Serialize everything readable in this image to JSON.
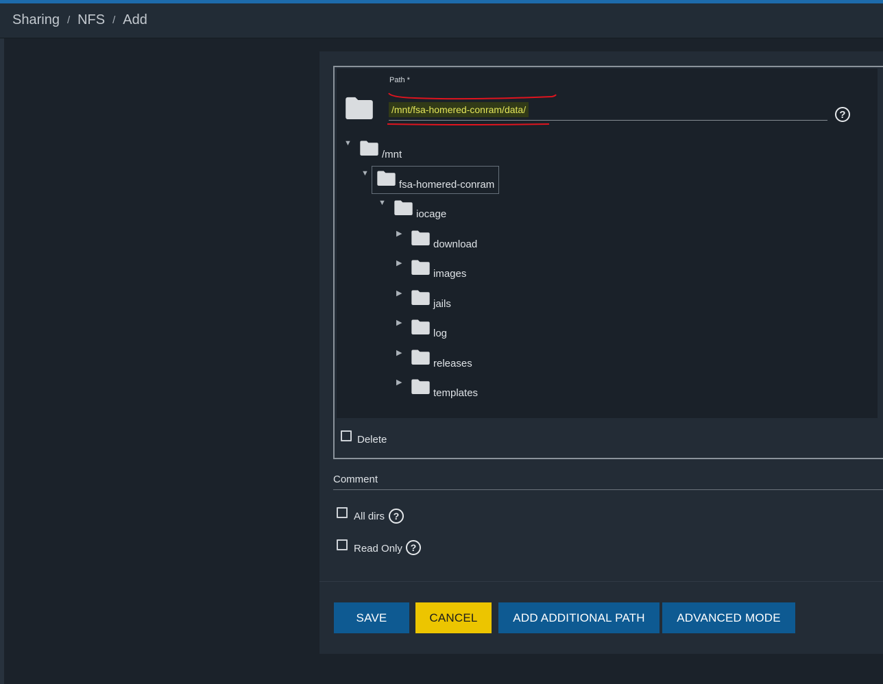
{
  "breadcrumb": {
    "items": [
      "Sharing",
      "NFS"
    ],
    "current": "Add",
    "separator": "/"
  },
  "path_field": {
    "label": "Path *",
    "value": "/mnt/fsa-homered-conram/data/",
    "help_icon": "help-circle-icon"
  },
  "tree": {
    "root": {
      "label": "/mnt",
      "expanded": true
    },
    "level1": {
      "label": "fsa-homered-conram",
      "expanded": true,
      "focused": true
    },
    "level2": {
      "label": "iocage",
      "expanded": true
    },
    "children": [
      {
        "label": "download",
        "expanded": false
      },
      {
        "label": "images",
        "expanded": false
      },
      {
        "label": "jails",
        "expanded": false
      },
      {
        "label": "log",
        "expanded": false
      },
      {
        "label": "releases",
        "expanded": false
      },
      {
        "label": "templates",
        "expanded": false
      }
    ]
  },
  "delete_checkbox": {
    "label": "Delete",
    "checked": false
  },
  "comment": {
    "label": "Comment",
    "value": ""
  },
  "options": {
    "all_dirs": {
      "label": "All dirs",
      "checked": false
    },
    "read_only": {
      "label": "Read Only",
      "checked": false
    }
  },
  "buttons": {
    "save": "SAVE",
    "cancel": "CANCEL",
    "add_path": "ADD ADDITIONAL PATH",
    "advanced": "ADVANCED MODE"
  },
  "colors": {
    "accent": "#1d6bab",
    "primary_button": "#0e5a92",
    "cancel_button": "#ecc500",
    "highlight_text": "#e5e75a",
    "annotation_red": "#e0141e"
  }
}
